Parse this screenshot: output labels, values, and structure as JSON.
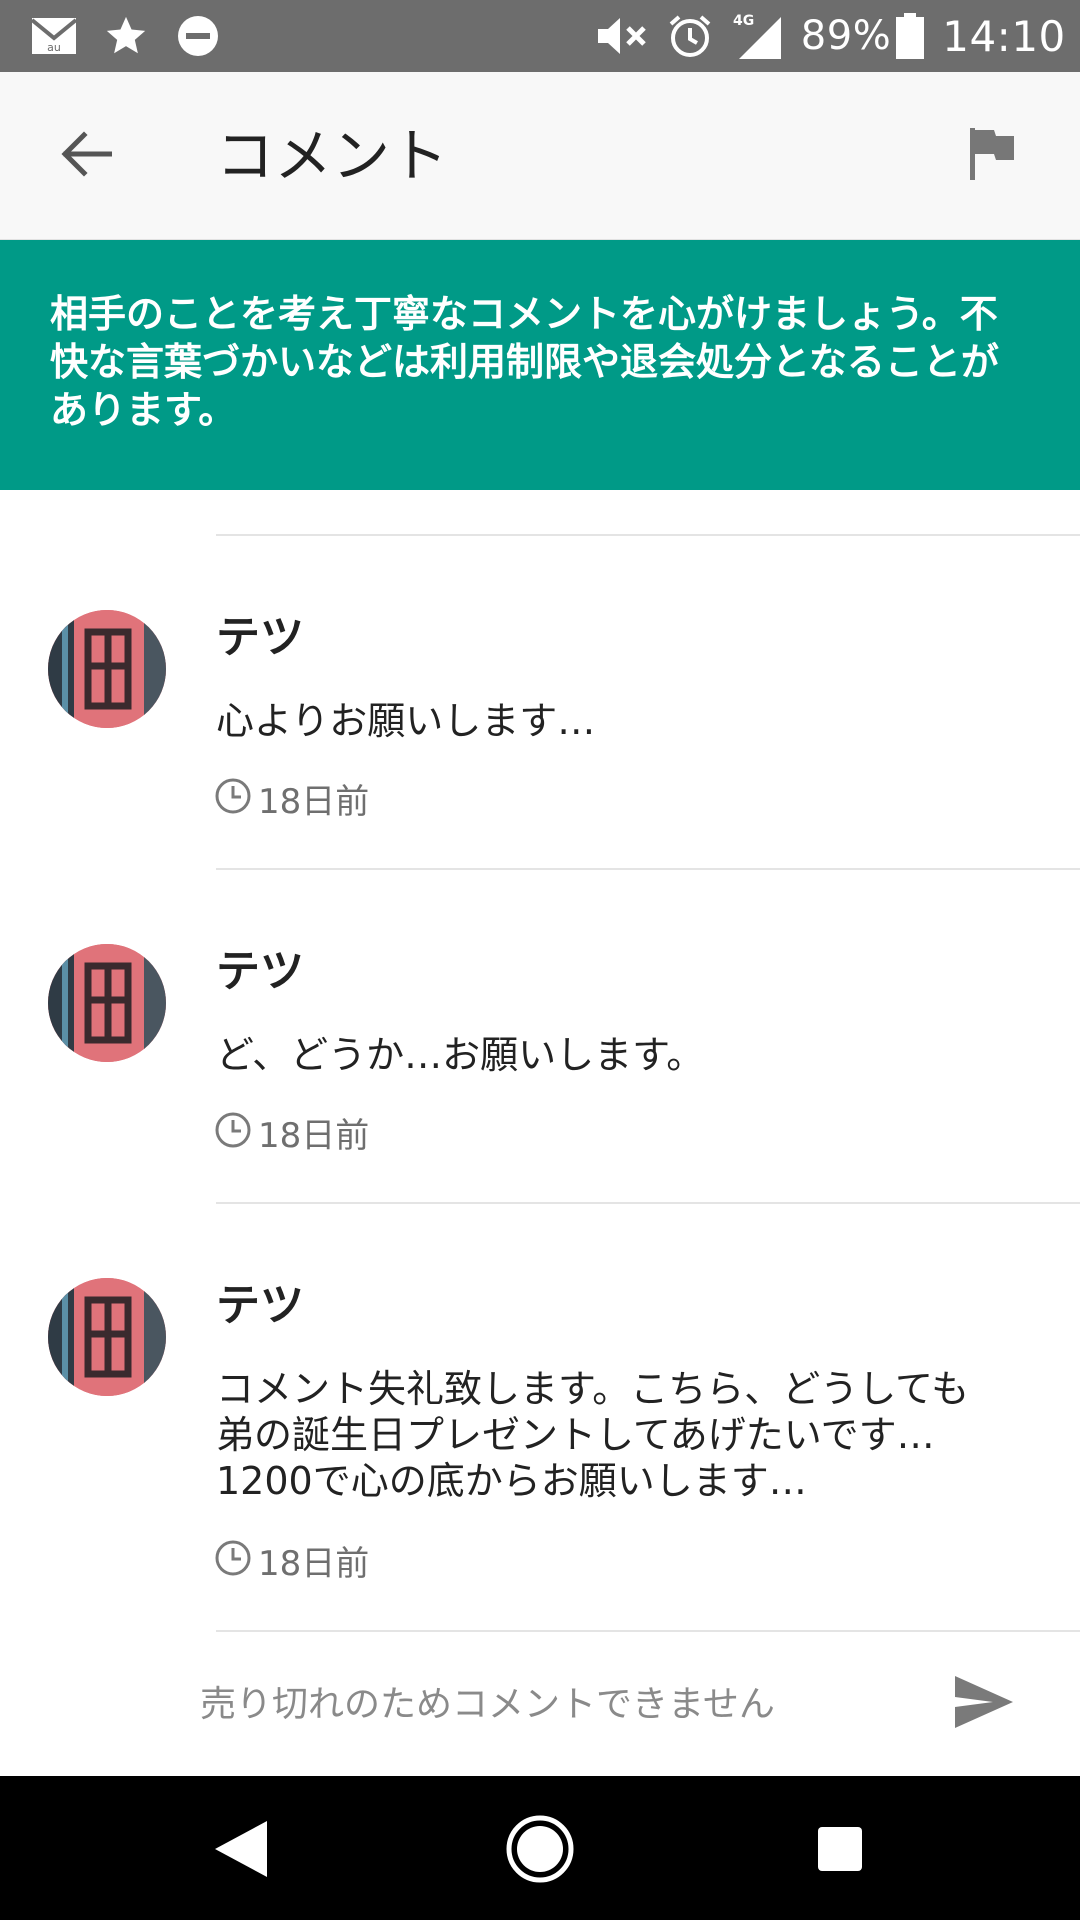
{
  "status_bar": {
    "icons_left": [
      "au-mail-icon",
      "star-icon",
      "do-not-disturb-icon"
    ],
    "icons_right": [
      "mute-icon",
      "alarm-icon",
      "signal-4g-icon",
      "battery-icon"
    ],
    "network": "4G",
    "battery": "89%",
    "time": "14:10"
  },
  "header": {
    "title": "コメント",
    "back_icon": "arrow-back-icon",
    "report_icon": "flag-icon"
  },
  "notice": {
    "text": "相手のことを考え丁寧なコメントを心がけましょう。不快な言葉づかいなどは利用制限や退会処分となることがあります。",
    "background": "#009a87"
  },
  "comments": [
    {
      "user": "テツ",
      "body": "心よりお願いします…",
      "time": "18日前"
    },
    {
      "user": "テツ",
      "body": "ど、どうか…お願いします。",
      "time": "18日前"
    },
    {
      "user": "テツ",
      "body": "コメント失礼致します。こちら、どうしても\n弟の誕生日プレゼントしてあげたいです…\n1200で心の底からお願いします…",
      "time": "18日前"
    }
  ],
  "comment_input": {
    "placeholder": "売り切れのためコメントできません",
    "value": ""
  },
  "nav_bar": {
    "buttons": [
      "nav-back-icon",
      "nav-home-icon",
      "nav-recents-icon"
    ]
  }
}
